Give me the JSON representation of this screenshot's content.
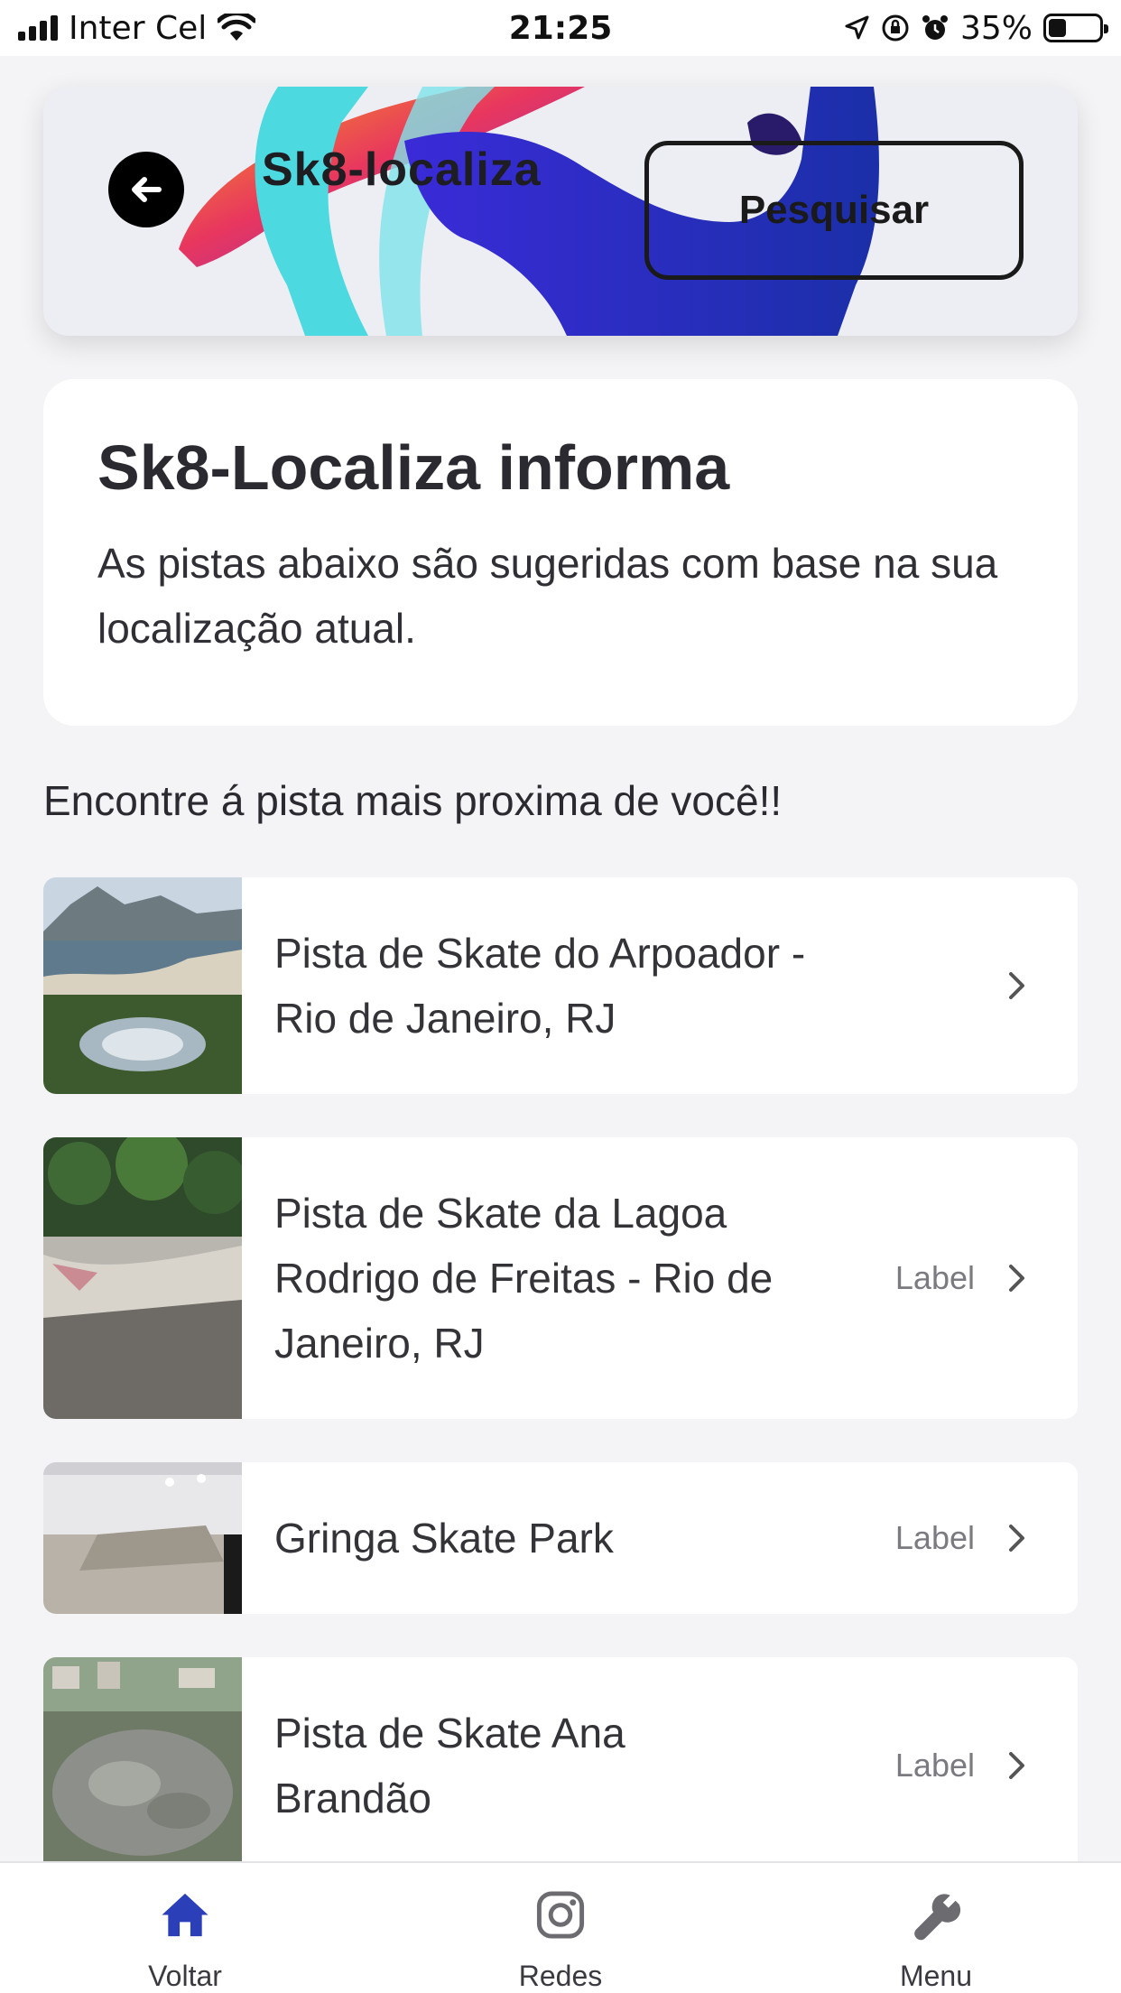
{
  "status_bar": {
    "carrier": "Inter Cel",
    "time": "21:25",
    "battery": "35%",
    "icons": [
      "signal-icon",
      "wifi-icon",
      "location-icon",
      "rotation-lock-icon",
      "alarm-icon",
      "battery-icon"
    ]
  },
  "header": {
    "title": "Sk8-localiza",
    "back_icon": "arrow-left-icon",
    "search_label": "Pesquisar"
  },
  "info_card": {
    "title": "Sk8-Localiza informa",
    "text": "As pistas abaixo são sugeridas com base na sua localização atual."
  },
  "section_heading": "Encontre á pista mais proxima de você!!",
  "parks": [
    {
      "title": "Pista de Skate do Arpoador -\nRio de Janeiro, RJ",
      "label": ""
    },
    {
      "title": " Pista de Skate da Lagoa\nRodrigo de Freitas - Rio de\nJaneiro, RJ",
      "label": "Label"
    },
    {
      "title": "Gringa Skate Park",
      "label": "Label"
    },
    {
      "title": "Pista de Skate Ana\nBrandão",
      "label": "Label"
    }
  ],
  "tabs": [
    {
      "label": "Voltar",
      "icon": "home-icon",
      "active": true
    },
    {
      "label": "Redes",
      "icon": "instagram-icon",
      "active": false
    },
    {
      "label": "Menu",
      "icon": "wrench-icon",
      "active": false
    }
  ],
  "colors": {
    "background": "#f4f4f6",
    "card": "#ffffff",
    "active_tab": "#2a3fb8",
    "inactive_tab": "#6b6b70"
  }
}
